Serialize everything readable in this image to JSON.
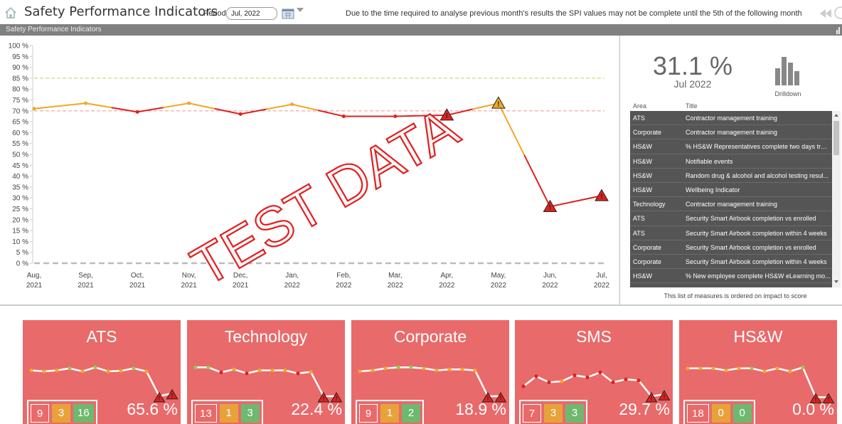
{
  "header": {
    "title": "Safety Performance Indicators",
    "period_label": "Period :",
    "period_value": "Jul, 2022",
    "notice": "Due to the time required to analyse previous month's results the SPI values may not be complete until the 5th of the following month"
  },
  "subheader": {
    "title": "Safety Performance Indicators"
  },
  "chart_data": {
    "type": "line",
    "x": [
      "Aug, 2021",
      "Sep, 2021",
      "Oct, 2021",
      "Nov, 2021",
      "Dec, 2021",
      "Jan, 2022",
      "Feb, 2022",
      "Mar, 2022",
      "Apr, 2022",
      "May, 2022",
      "Jun, 2022",
      "Jul, 2022"
    ],
    "x_labels": [
      [
        "Aug,",
        "2021"
      ],
      [
        "Sep,",
        "2021"
      ],
      [
        "Oct,",
        "2021"
      ],
      [
        "Nov,",
        "2021"
      ],
      [
        "Dec,",
        "2021"
      ],
      [
        "Jan,",
        "2022"
      ],
      [
        "Feb,",
        "2022"
      ],
      [
        "Mar,",
        "2022"
      ],
      [
        "Apr,",
        "2022"
      ],
      [
        "May,",
        "2022"
      ],
      [
        "Jun,",
        "2022"
      ],
      [
        "Jul,",
        "2022"
      ]
    ],
    "values": [
      71,
      73.5,
      69.5,
      73.5,
      68.5,
      73,
      67.5,
      67.5,
      68,
      73.5,
      26,
      31
    ],
    "point_status": [
      "amber",
      "amber",
      "red",
      "amber",
      "red",
      "amber",
      "red",
      "red",
      "red",
      "amber",
      "red",
      "red"
    ],
    "warning_markers": [
      8,
      9,
      10,
      11
    ],
    "reference_lines": [
      {
        "value": 85,
        "color": "#d7d76a"
      },
      {
        "value": 70,
        "color": "#f3a0a0"
      },
      {
        "value": 0,
        "color": "#bbbbbb"
      }
    ],
    "y_ticks": [
      "0 %",
      "5 %",
      "10 %",
      "15 %",
      "20 %",
      "25 %",
      "30 %",
      "35 %",
      "40 %",
      "45 %",
      "50 %",
      "55 %",
      "60 %",
      "65 %",
      "70 %",
      "75 %",
      "80 %",
      "85 %",
      "90 %",
      "95 %",
      "100 %"
    ],
    "ylim": [
      0,
      100
    ],
    "watermark": "TEST DATA"
  },
  "kpi": {
    "value": "31.1 %",
    "period": "Jul 2022",
    "drilldown_label": "Drilldown"
  },
  "measures": {
    "header_area": "Area",
    "header_title": "Title",
    "rows": [
      {
        "area": "ATS",
        "title": "Contractor management training"
      },
      {
        "area": "Corporate",
        "title": "Contractor management training"
      },
      {
        "area": "HS&W",
        "title": "% HS&W Representatives complete two days trai..."
      },
      {
        "area": "HS&W",
        "title": "Notifiable events"
      },
      {
        "area": "HS&W",
        "title": "Random drug & alcohol and alcohol testing resul..."
      },
      {
        "area": "HS&W",
        "title": "Wellbeing Indicator"
      },
      {
        "area": "Technology",
        "title": "Contractor management training"
      },
      {
        "area": "ATS",
        "title": "Security Smart Airbook completion vs enrolled"
      },
      {
        "area": "ATS",
        "title": "Security Smart Airbook completion within 4 weeks"
      },
      {
        "area": "Corporate",
        "title": "Security Smart Airbook completion vs enrolled"
      },
      {
        "area": "Corporate",
        "title": "Security Smart Airbook completion within 4 weeks"
      },
      {
        "area": "HS&W",
        "title": "% New employee complete HS&W eLearning mo..."
      }
    ],
    "note": "This list of measures is ordered on impact to score"
  },
  "tiles": [
    {
      "name": "ATS",
      "red": "9",
      "amber": "3",
      "green": "16",
      "percent": "65.6 %",
      "spark": [
        72,
        70,
        72,
        76,
        70,
        78,
        70,
        71,
        76,
        70,
        20,
        26
      ],
      "spark_status": [
        "amber",
        "amber",
        "amber",
        "green",
        "amber",
        "green",
        "amber",
        "amber",
        "green",
        "amber",
        "red",
        "red"
      ]
    },
    {
      "name": "Technology",
      "red": "13",
      "amber": "1",
      "green": "3",
      "percent": "22.4 %",
      "spark": [
        78,
        78,
        68,
        74,
        66,
        72,
        72,
        72,
        66,
        69,
        20,
        20
      ],
      "spark_status": [
        "green",
        "green",
        "red",
        "amber",
        "red",
        "amber",
        "amber",
        "amber",
        "red",
        "amber",
        "red",
        "red"
      ]
    },
    {
      "name": "Corporate",
      "red": "9",
      "amber": "1",
      "green": "2",
      "percent": "18.9 %",
      "spark": [
        70,
        72,
        76,
        78,
        78,
        76,
        72,
        74,
        74,
        72,
        20,
        20
      ],
      "spark_status": [
        "amber",
        "amber",
        "amber",
        "green",
        "green",
        "amber",
        "amber",
        "amber",
        "amber",
        "amber",
        "red",
        "red"
      ]
    },
    {
      "name": "SMS",
      "red": "7",
      "amber": "3",
      "green": "3",
      "percent": "29.7 %",
      "spark": [
        40,
        60,
        48,
        50,
        62,
        58,
        68,
        48,
        54,
        52,
        20,
        24
      ],
      "spark_status": [
        "red",
        "red",
        "red",
        "amber",
        "red",
        "red",
        "red",
        "red",
        "red",
        "red",
        "red",
        "red"
      ]
    },
    {
      "name": "HS&W",
      "red": "18",
      "amber": "0",
      "green": "0",
      "percent": "0.0 %",
      "spark": [
        76,
        76,
        76,
        72,
        76,
        76,
        70,
        76,
        70,
        78,
        18,
        18
      ],
      "spark_status": [
        "amber",
        "amber",
        "amber",
        "amber",
        "amber",
        "green",
        "amber",
        "amber",
        "amber",
        "green",
        "red",
        "red"
      ]
    }
  ],
  "colors": {
    "red": "#e02020",
    "amber": "#f0a824",
    "green": "#8cd14a",
    "tile": "#e96a6a"
  }
}
